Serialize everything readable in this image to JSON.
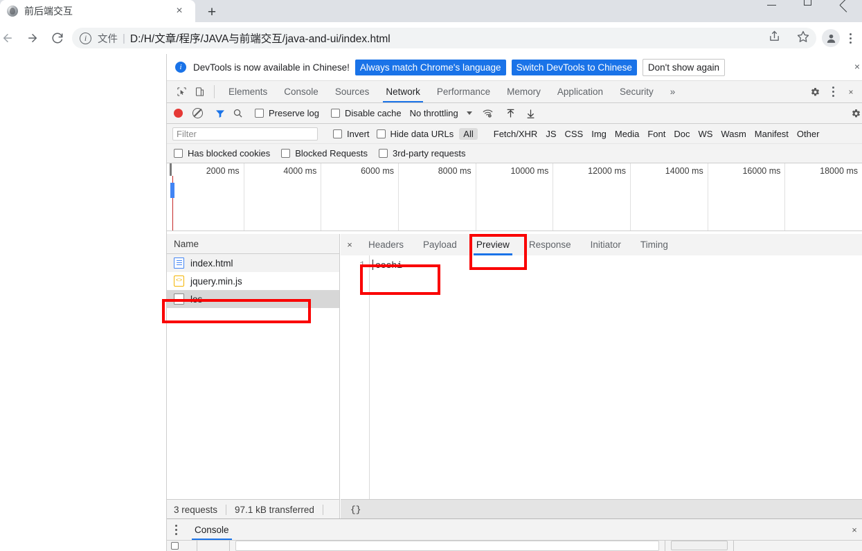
{
  "browser": {
    "tab": {
      "title": "前后端交互",
      "favicon": "globe-favicon",
      "close": "×"
    },
    "new_tab": "+",
    "window_controls": [
      "minimize",
      "maximize",
      "close"
    ],
    "nav": {
      "back": "←",
      "forward": "→",
      "reload": "⟳",
      "share": "share-icon",
      "bookmark": "star-icon",
      "profile": "avatar-icon",
      "menu": "kebab-icon"
    },
    "omnibox": {
      "info_icon": "i",
      "scheme_label": "文件",
      "separator": "|",
      "url": "D:/H/文章/程序/JAVA与前端交互/java-and-ui/index.html"
    }
  },
  "devtools": {
    "notification": {
      "icon": "i",
      "message": "DevTools is now available in Chinese!",
      "buttons": [
        {
          "label": "Always match Chrome's language",
          "style": "primary"
        },
        {
          "label": "Switch DevTools to Chinese",
          "style": "primary"
        },
        {
          "label": "Don't show again",
          "style": "secondary"
        }
      ],
      "close": "×"
    },
    "main_tabs": {
      "inspect_icon": "inspect-cursor-icon",
      "device_icon": "device-toolbar-icon",
      "items": [
        {
          "label": "Elements",
          "active": false
        },
        {
          "label": "Console",
          "active": false
        },
        {
          "label": "Sources",
          "active": false
        },
        {
          "label": "Network",
          "active": true
        },
        {
          "label": "Performance",
          "active": false
        },
        {
          "label": "Memory",
          "active": false
        },
        {
          "label": "Application",
          "active": false
        },
        {
          "label": "Security",
          "active": false
        }
      ],
      "more": "»",
      "settings_icon": "gear-icon",
      "kebab_icon": "kebab-icon",
      "close": "×"
    },
    "network_controls": {
      "record": "record-button",
      "clear": "clear-button",
      "filter_icon": "funnel-icon",
      "search_icon": "search-icon",
      "preserve_log": "Preserve log",
      "disable_cache": "Disable cache",
      "throttling": "No throttling",
      "wifi_icon": "network-conditions-icon",
      "import_icon": "import-har-icon",
      "export_icon": "export-har-icon",
      "settings_icon": "gear-icon"
    },
    "filter_bar": {
      "placeholder": "Filter",
      "value": "",
      "invert": "Invert",
      "hide_data_urls": "Hide data URLs",
      "types": [
        "All",
        "Fetch/XHR",
        "JS",
        "CSS",
        "Img",
        "Media",
        "Font",
        "Doc",
        "WS",
        "Wasm",
        "Manifest",
        "Other"
      ],
      "active_type": "All"
    },
    "filter_bar2": {
      "has_blocked_cookies": "Has blocked cookies",
      "blocked_requests": "Blocked Requests",
      "third_party": "3rd-party requests"
    },
    "overview": {
      "ticks": [
        "2000 ms",
        "4000 ms",
        "6000 ms",
        "8000 ms",
        "10000 ms",
        "12000 ms",
        "14000 ms",
        "16000 ms",
        "18000 ms"
      ]
    },
    "request_list": {
      "column_header": "Name",
      "rows": [
        {
          "name": "index.html",
          "icon": "html-document-icon",
          "selected": false
        },
        {
          "name": "jquery.min.js",
          "icon": "javascript-file-icon",
          "selected": false
        },
        {
          "name": "los",
          "icon": "generic-file-icon",
          "selected": true
        }
      ],
      "status": {
        "requests": "3 requests",
        "transferred": "97.1 kB transferred"
      }
    },
    "detail": {
      "close": "×",
      "tabs": [
        {
          "label": "Headers",
          "active": false
        },
        {
          "label": "Payload",
          "active": false
        },
        {
          "label": "Preview",
          "active": true
        },
        {
          "label": "Response",
          "active": false
        },
        {
          "label": "Initiator",
          "active": false
        },
        {
          "label": "Timing",
          "active": false
        }
      ],
      "preview": {
        "line_number": "1",
        "content": "ceshi"
      },
      "status": "{}"
    },
    "drawer": {
      "kebab": "kebab-icon",
      "tabs": [
        {
          "label": "Console",
          "active": true
        }
      ],
      "close": "×"
    }
  },
  "annotations": {
    "color": "#fa0000",
    "boxes": [
      {
        "name": "preview-tab-highlight"
      },
      {
        "name": "preview-content-highlight"
      },
      {
        "name": "los-request-highlight"
      }
    ]
  }
}
